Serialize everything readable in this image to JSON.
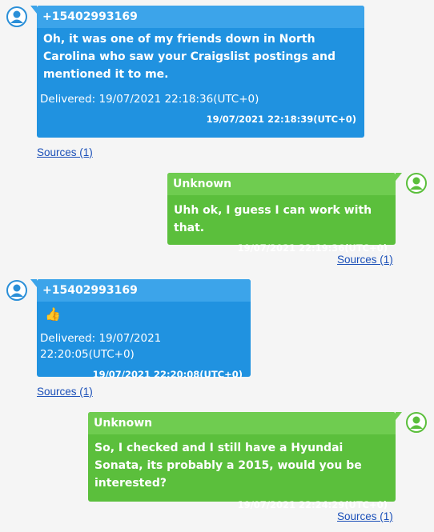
{
  "messages": [
    {
      "direction": "in",
      "sender": "+15402993169",
      "text": "Oh, it was one of my friends down in North Carolina who saw your Craigslist postings and mentioned it to me.",
      "delivered": "Delivered: 19/07/2021 22:18:36(UTC+0)",
      "timestamp": "19/07/2021 22:18:39(UTC+0)",
      "sources": "Sources (1)"
    },
    {
      "direction": "out",
      "sender": "Unknown",
      "text": "Uhh ok, I guess I can work with that.",
      "timestamp": "19/07/2021 22:19:36(UTC+0)",
      "sources": "Sources (1)"
    },
    {
      "direction": "in",
      "sender": "+15402993169",
      "text": "👍",
      "text_icon": "thumbs-up-icon",
      "delivered": "Delivered: 19/07/2021 22:20:05(UTC+0)",
      "timestamp": "19/07/2021 22:20:08(UTC+0)",
      "sources": "Sources (1)"
    },
    {
      "direction": "out",
      "sender": "Unknown",
      "text": "So, I checked and I still have a Hyundai Sonata, its probably a 2015, would you be interested?",
      "timestamp": "19/07/2021 22:24:29(UTC+0)",
      "sources": "Sources (1)"
    }
  ],
  "colors": {
    "incoming_bubble": "#2092e0",
    "incoming_header": "#3ca4ea",
    "outgoing_bubble": "#5bbf3c",
    "outgoing_header": "#6fcc50",
    "link": "#1a4fb8"
  }
}
